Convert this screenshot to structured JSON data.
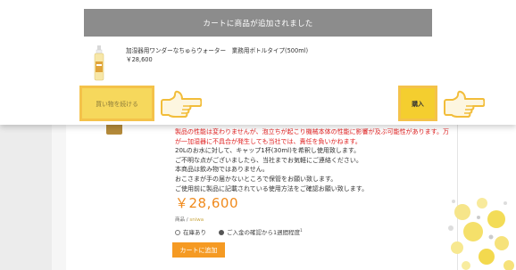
{
  "modal": {
    "header": "カートに商品が追加されました",
    "product_name": "加湿器用ワンダーなちゅらウォーター　業務用ボトルタイプ(500ml)",
    "product_price": "￥28,600",
    "continue_label": "買い物を続ける",
    "buy_label": "購入"
  },
  "product": {
    "desc_red": "製品の性能は変わりませんが、泡立ちが起こり機械本体の性能に影響が及ぶ可能性があります。万が一加湿器に不具合が発生しても当社では、責任を負いかねます。",
    "desc_lines": [
      "20Lのお水に対して、キャップ1杯(30ml)を希釈し使用致します。",
      "ご不明な点がございましたら、当社までお気軽にご連絡ください。",
      "本商品は飲み物ではありません。",
      "おこさまが手の届かないところで保管をお願い致します。",
      "ご使用前に製品に記載されている使用方法をご確認お願い致します。"
    ],
    "price": "￥28,600",
    "sku_label": "商品 / ",
    "sku_value": "sniwa",
    "stock_label": "在庫あり",
    "shipping_label": "ご入金の確認から1週間程度",
    "shipping_sup": "1",
    "add_to_cart_label": "カートに追加"
  },
  "colors": {
    "accent_orange": "#f59a23",
    "highlight_yellow": "#f4ce2f",
    "error_red": "#e02020",
    "header_gray": "#8c8c8c"
  },
  "icons": [
    "bottle-icon",
    "pointing-hand-icon",
    "check-circle-icon",
    "info-circle-icon"
  ]
}
